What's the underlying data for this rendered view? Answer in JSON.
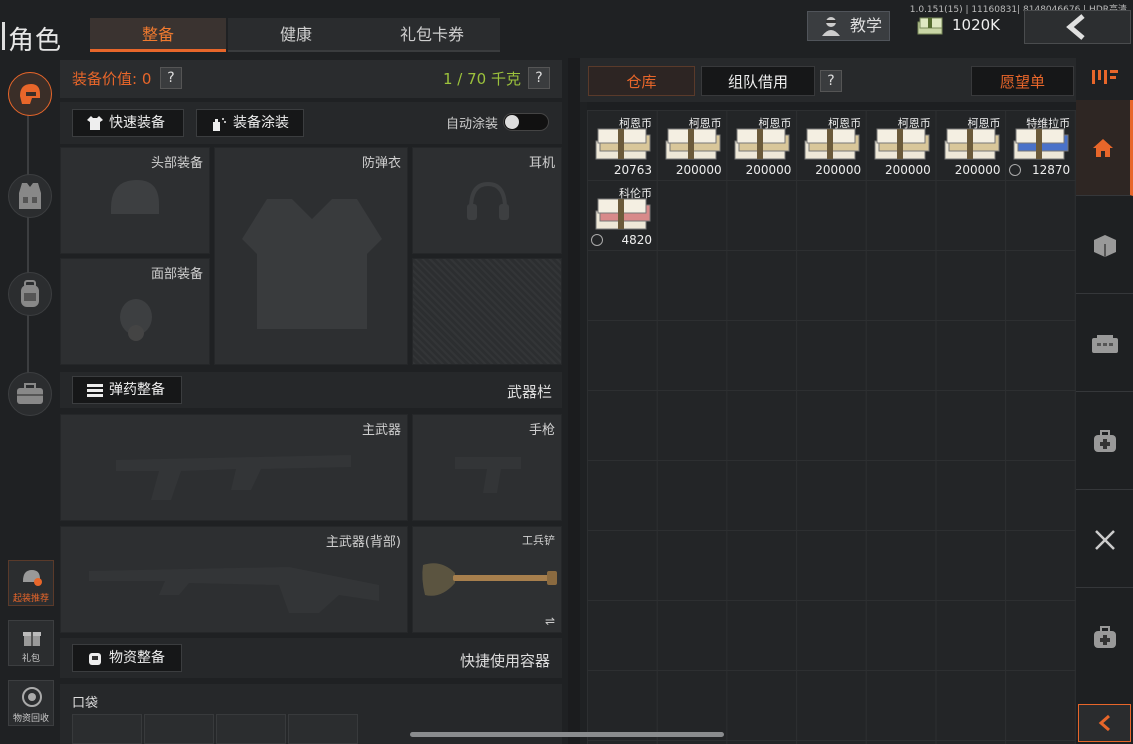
{
  "header": {
    "title": "角色",
    "tabs": [
      "整备",
      "健康",
      "礼包卡券"
    ],
    "version": "1.0.151(15) | 11160831| 8148046676 | HDR高清",
    "teach_label": "教学",
    "money": "1020K"
  },
  "left_nav": {
    "small_buttons": [
      "起装推荐",
      "礼包",
      "物资回收"
    ]
  },
  "equip": {
    "value_label": "装备价值: 0",
    "weight_label": "1 / 70 千克",
    "quick_equip": "快速装备",
    "paint": "装备涂装",
    "auto_paint": "自动涂装",
    "slots": {
      "head": "头部装备",
      "armor": "防弹衣",
      "ear": "耳机",
      "face": "面部装备"
    },
    "ammo_btn": "弹药整备",
    "weapon_bar": "武器栏",
    "main_weapon": "主武器",
    "pistol": "手枪",
    "main_weapon_back": "主武器(背部)",
    "shovel": "工兵铲",
    "supply_btn": "物资整备",
    "quick_container": "快捷使用容器",
    "pocket": "口袋"
  },
  "stash": {
    "tab_warehouse": "仓库",
    "tab_team": "组队借用",
    "wishlist": "愿望单",
    "items": [
      {
        "name": "柯恩币",
        "value": "20763",
        "color": "#d9c79a",
        "coin": false
      },
      {
        "name": "柯恩币",
        "value": "200000",
        "color": "#d9c79a",
        "coin": false
      },
      {
        "name": "柯恩币",
        "value": "200000",
        "color": "#d9c79a",
        "coin": false
      },
      {
        "name": "柯恩币",
        "value": "200000",
        "color": "#d9c79a",
        "coin": false
      },
      {
        "name": "柯恩币",
        "value": "200000",
        "color": "#d9c79a",
        "coin": false
      },
      {
        "name": "柯恩币",
        "value": "200000",
        "color": "#d9c79a",
        "coin": false
      },
      {
        "name": "特维拉币",
        "value": "12870",
        "color": "#4a72c9",
        "coin": true
      },
      {
        "name": "科伦币",
        "value": "4820",
        "color": "#d88a8a",
        "coin": true
      }
    ]
  },
  "colors": {
    "accent": "#e8662a",
    "weight": "#9cc23c"
  }
}
